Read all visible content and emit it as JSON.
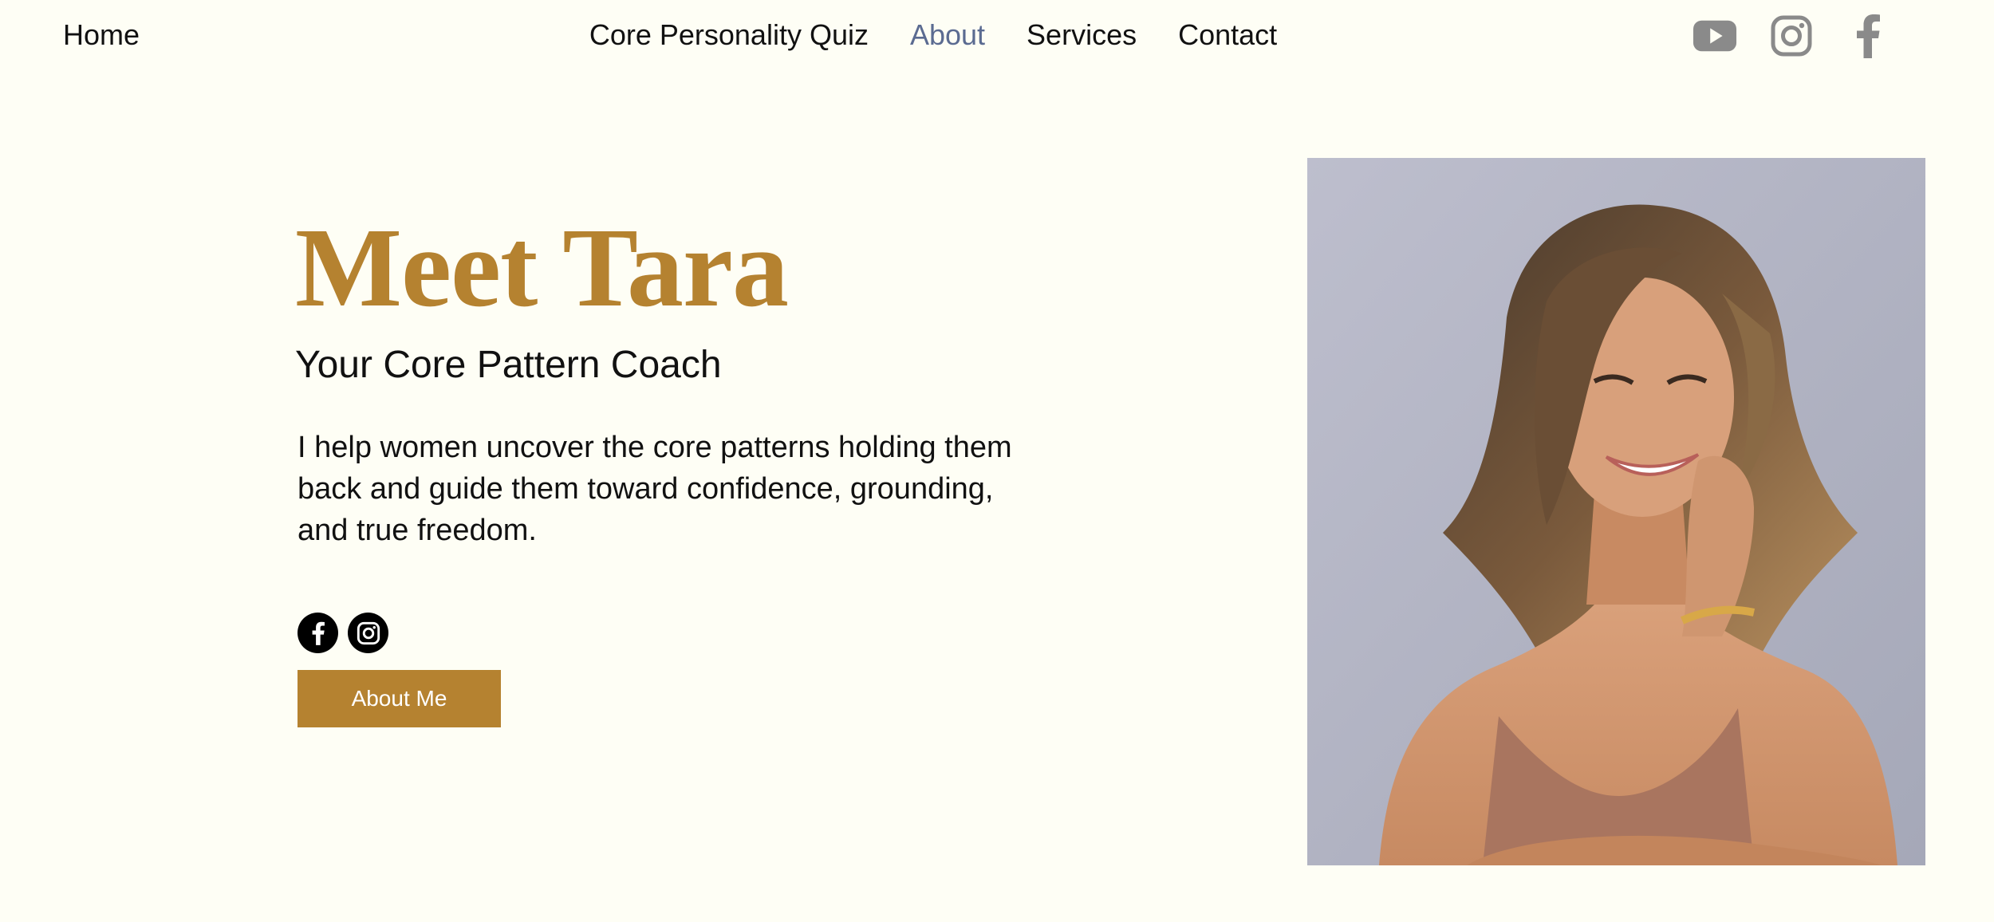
{
  "header": {
    "home_label": "Home",
    "nav": [
      {
        "label": "Core Personality Quiz",
        "active": false
      },
      {
        "label": "About",
        "active": true
      },
      {
        "label": "Services",
        "active": false
      },
      {
        "label": "Contact",
        "active": false
      }
    ],
    "social": [
      "youtube-icon",
      "instagram-icon",
      "facebook-icon"
    ],
    "social_icon_color": "#8A8A8A"
  },
  "hero": {
    "title": "Meet Tara",
    "subtitle": "Your Core Pattern Coach",
    "description": "I help women uncover the core patterns holding them back and guide them toward confidence, grounding, and true freedom.",
    "social": [
      "facebook-icon",
      "instagram-icon"
    ],
    "button_label": "About Me"
  },
  "colors": {
    "background": "#FEFEF5",
    "accent": "#B58230",
    "nav_active": "#5B6B91",
    "text": "#111111",
    "photo_background": "#B7B8C8"
  }
}
